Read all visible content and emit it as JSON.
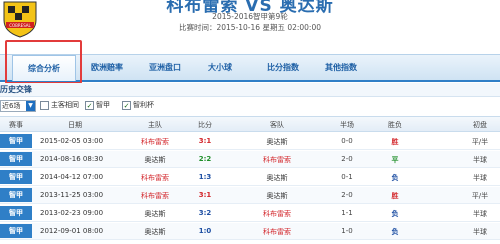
{
  "header": {
    "title": "科布雷索 VS 奥达斯",
    "subtitle": "2015-2016智甲第9轮",
    "time": "比赛时间：2015-10-16 星期五 02:00:00"
  },
  "tabs": [
    {
      "label": "综合分析",
      "active": true
    },
    {
      "label": "欧洲赔率",
      "active": false
    },
    {
      "label": "亚洲盘口",
      "active": false
    },
    {
      "label": "大小球",
      "active": false
    },
    {
      "label": "比分指数",
      "active": false
    },
    {
      "label": "其他指数",
      "active": false
    }
  ],
  "section": {
    "title": "历史交锋"
  },
  "filters": {
    "select_value": "近6场",
    "checkbox_same_home_away": {
      "label": "主客相同",
      "checked": false
    },
    "checkbox_league": {
      "label": "智甲",
      "checked": true
    },
    "checkbox_odds": {
      "label": "智利杯",
      "checked": true
    }
  },
  "table": {
    "headers": [
      "赛事",
      "日期",
      "主队",
      "比分",
      "客队",
      "半场",
      "胜负",
      "初盘"
    ],
    "rows": [
      {
        "comp": "智甲",
        "date": "2015-02-05 03:00",
        "home": "科布雷索",
        "score": "3:1",
        "away": "奥达斯",
        "half": "0-0",
        "result": "胜",
        "odds": "平/半"
      },
      {
        "comp": "智甲",
        "date": "2014-08-16 08:30",
        "home": "奥达斯",
        "score": "2:2",
        "away": "科布雷索",
        "half": "2-0",
        "result": "平",
        "odds": "半球"
      },
      {
        "comp": "智甲",
        "date": "2014-04-12 07:00",
        "home": "科布雷索",
        "score": "1:3",
        "away": "奥达斯",
        "half": "0-1",
        "result": "负",
        "odds": "半球"
      },
      {
        "comp": "智甲",
        "date": "2013-11-25 03:00",
        "home": "科布雷索",
        "score": "3:1",
        "away": "奥达斯",
        "half": "2-0",
        "result": "胜",
        "odds": "平/半"
      },
      {
        "comp": "智甲",
        "date": "2013-02-23 09:00",
        "home": "奥达斯",
        "score": "3:2",
        "away": "科布雷索",
        "half": "1-1",
        "result": "负",
        "odds": "半球"
      },
      {
        "comp": "智甲",
        "date": "2012-09-01 08:00",
        "home": "奥达斯",
        "score": "1:0",
        "away": "科布雷索",
        "half": "1-0",
        "result": "负",
        "odds": "半球"
      }
    ]
  },
  "colors": {
    "accent": "#2f7fc7",
    "highlight": "#e23b3b",
    "win": "#d3262b",
    "draw": "#1f8f2a",
    "loss": "#1e4fa3"
  }
}
